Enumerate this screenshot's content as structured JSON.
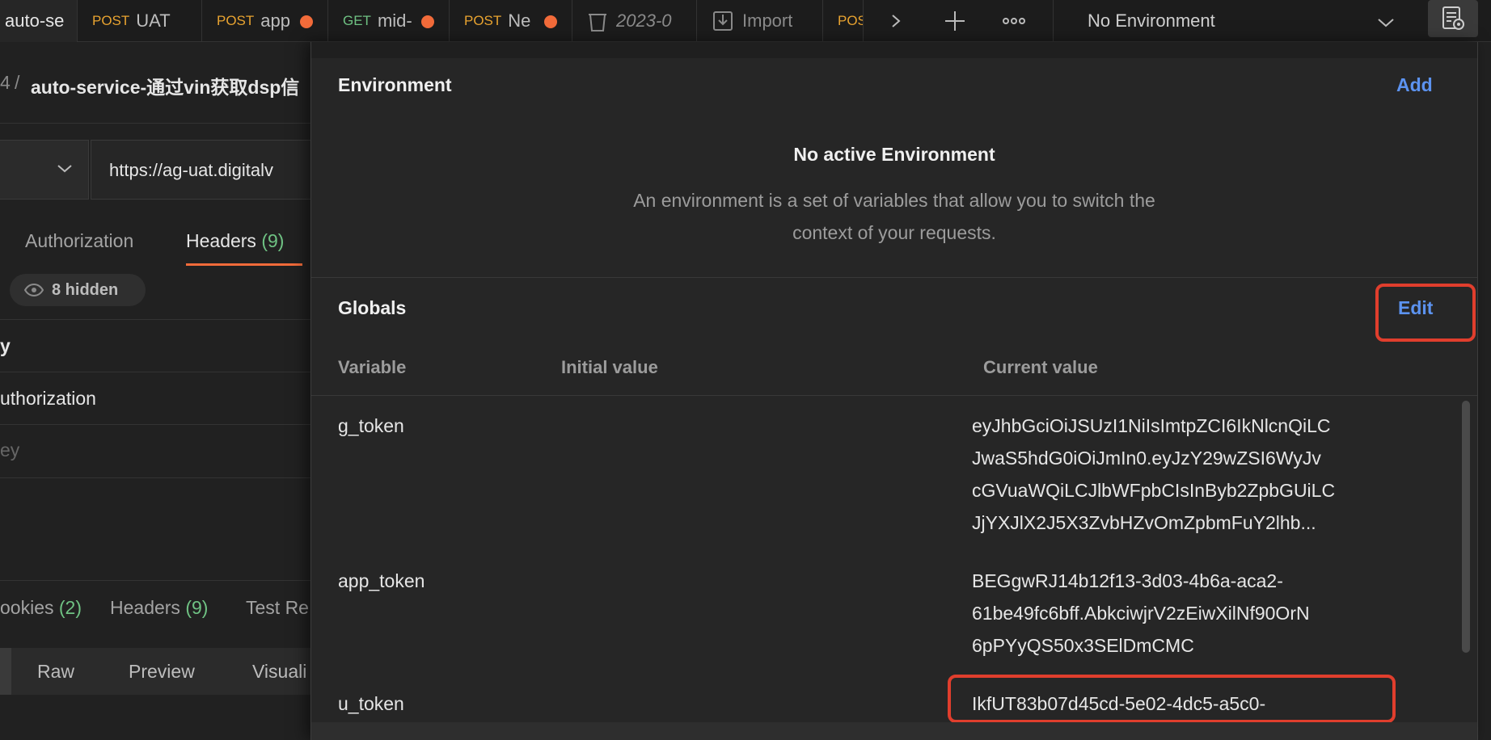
{
  "tabs": [
    {
      "method": "",
      "title": "auto-se",
      "active": true
    },
    {
      "method": "POST",
      "title": "UAT"
    },
    {
      "method": "POST",
      "title": "app",
      "unsaved": true
    },
    {
      "method": "GET",
      "title": "mid-",
      "unsaved": true
    },
    {
      "method": "POST",
      "title": "Ne",
      "unsaved": true
    },
    {
      "method": "",
      "title": "2023-0"
    },
    {
      "method": "",
      "title": "Import"
    },
    {
      "method": "POS",
      "title": ""
    }
  ],
  "colors": {
    "post": "#e8a330",
    "get": "#6fc283",
    "unsaved_dot": "#f26b3a",
    "link": "#5c93f0",
    "highlight": "#e03e2d",
    "accent_tab": "#f26b3a",
    "count": "#6fc283"
  },
  "icons": {
    "tabs_more": "chevron-right-icon",
    "new_tab": "plus-icon",
    "tab_options": "ellipsis-icon",
    "env_dropdown": "chevron-down-icon",
    "env_quicklook": "environment-quicklook-icon",
    "collection_tab": "trash-folder-icon",
    "import_tab": "import-icon",
    "hidden_headers": "eye-icon"
  },
  "environment_selector": {
    "value": "No Environment"
  },
  "request": {
    "breadcrumb_separator_left": "4",
    "breadcrumb_separator": "/",
    "name": "auto-service-通过vin获取dsp信",
    "url": "https://ag-uat.digitalv",
    "tabs": {
      "authorization": "Authorization",
      "headers": "Headers",
      "headers_count": "(9)"
    },
    "hidden_badge": "8 hidden",
    "header_rows": {
      "key_col": "y",
      "row1": "uthorization",
      "placeholder": "ey"
    },
    "response_tabs": {
      "cookies": "ookies",
      "cookies_count": "(2)",
      "headers": "Headers",
      "headers_count": "(9)",
      "test_results": "Test Re"
    },
    "body_view_tabs": {
      "raw": "Raw",
      "preview": "Preview",
      "visualize": "Visuali"
    }
  },
  "environment_panel": {
    "title": "Environment",
    "add_label": "Add",
    "empty_title": "No active Environment",
    "empty_desc_line1": "An environment is a set of variables that allow you to switch the",
    "empty_desc_line2": "context of your requests."
  },
  "globals_panel": {
    "title": "Globals",
    "edit_label": "Edit",
    "columns": {
      "variable": "Variable",
      "initial": "Initial value",
      "current": "Current value"
    },
    "rows": [
      {
        "name": "g_token",
        "current_lines": [
          "eyJhbGciOiJSUzI1NiIsImtpZCI6IkNlcnQiLC",
          "JwaS5hdG0iOiJmIn0.eyJzY29wZSI6WyJv",
          "cGVuaWQiLCJlbWFpbCIsInByb2ZpbGUiLC",
          "JjYXJlX2J5X3ZvbHZvOmZpbmFuY2lhb..."
        ]
      },
      {
        "name": "app_token",
        "current_lines": [
          "BEGgwRJ14b12f13-3d03-4b6a-aca2-",
          "61be49fc6bff.AbkciwjrV2zEiwXilNf90OrN",
          "6pPYyQS50x3SElDmCMC"
        ]
      },
      {
        "name": "u_token",
        "current_lines": [
          "IkfUT83b07d45cd-5e02-4dc5-a5c0-"
        ]
      }
    ]
  }
}
